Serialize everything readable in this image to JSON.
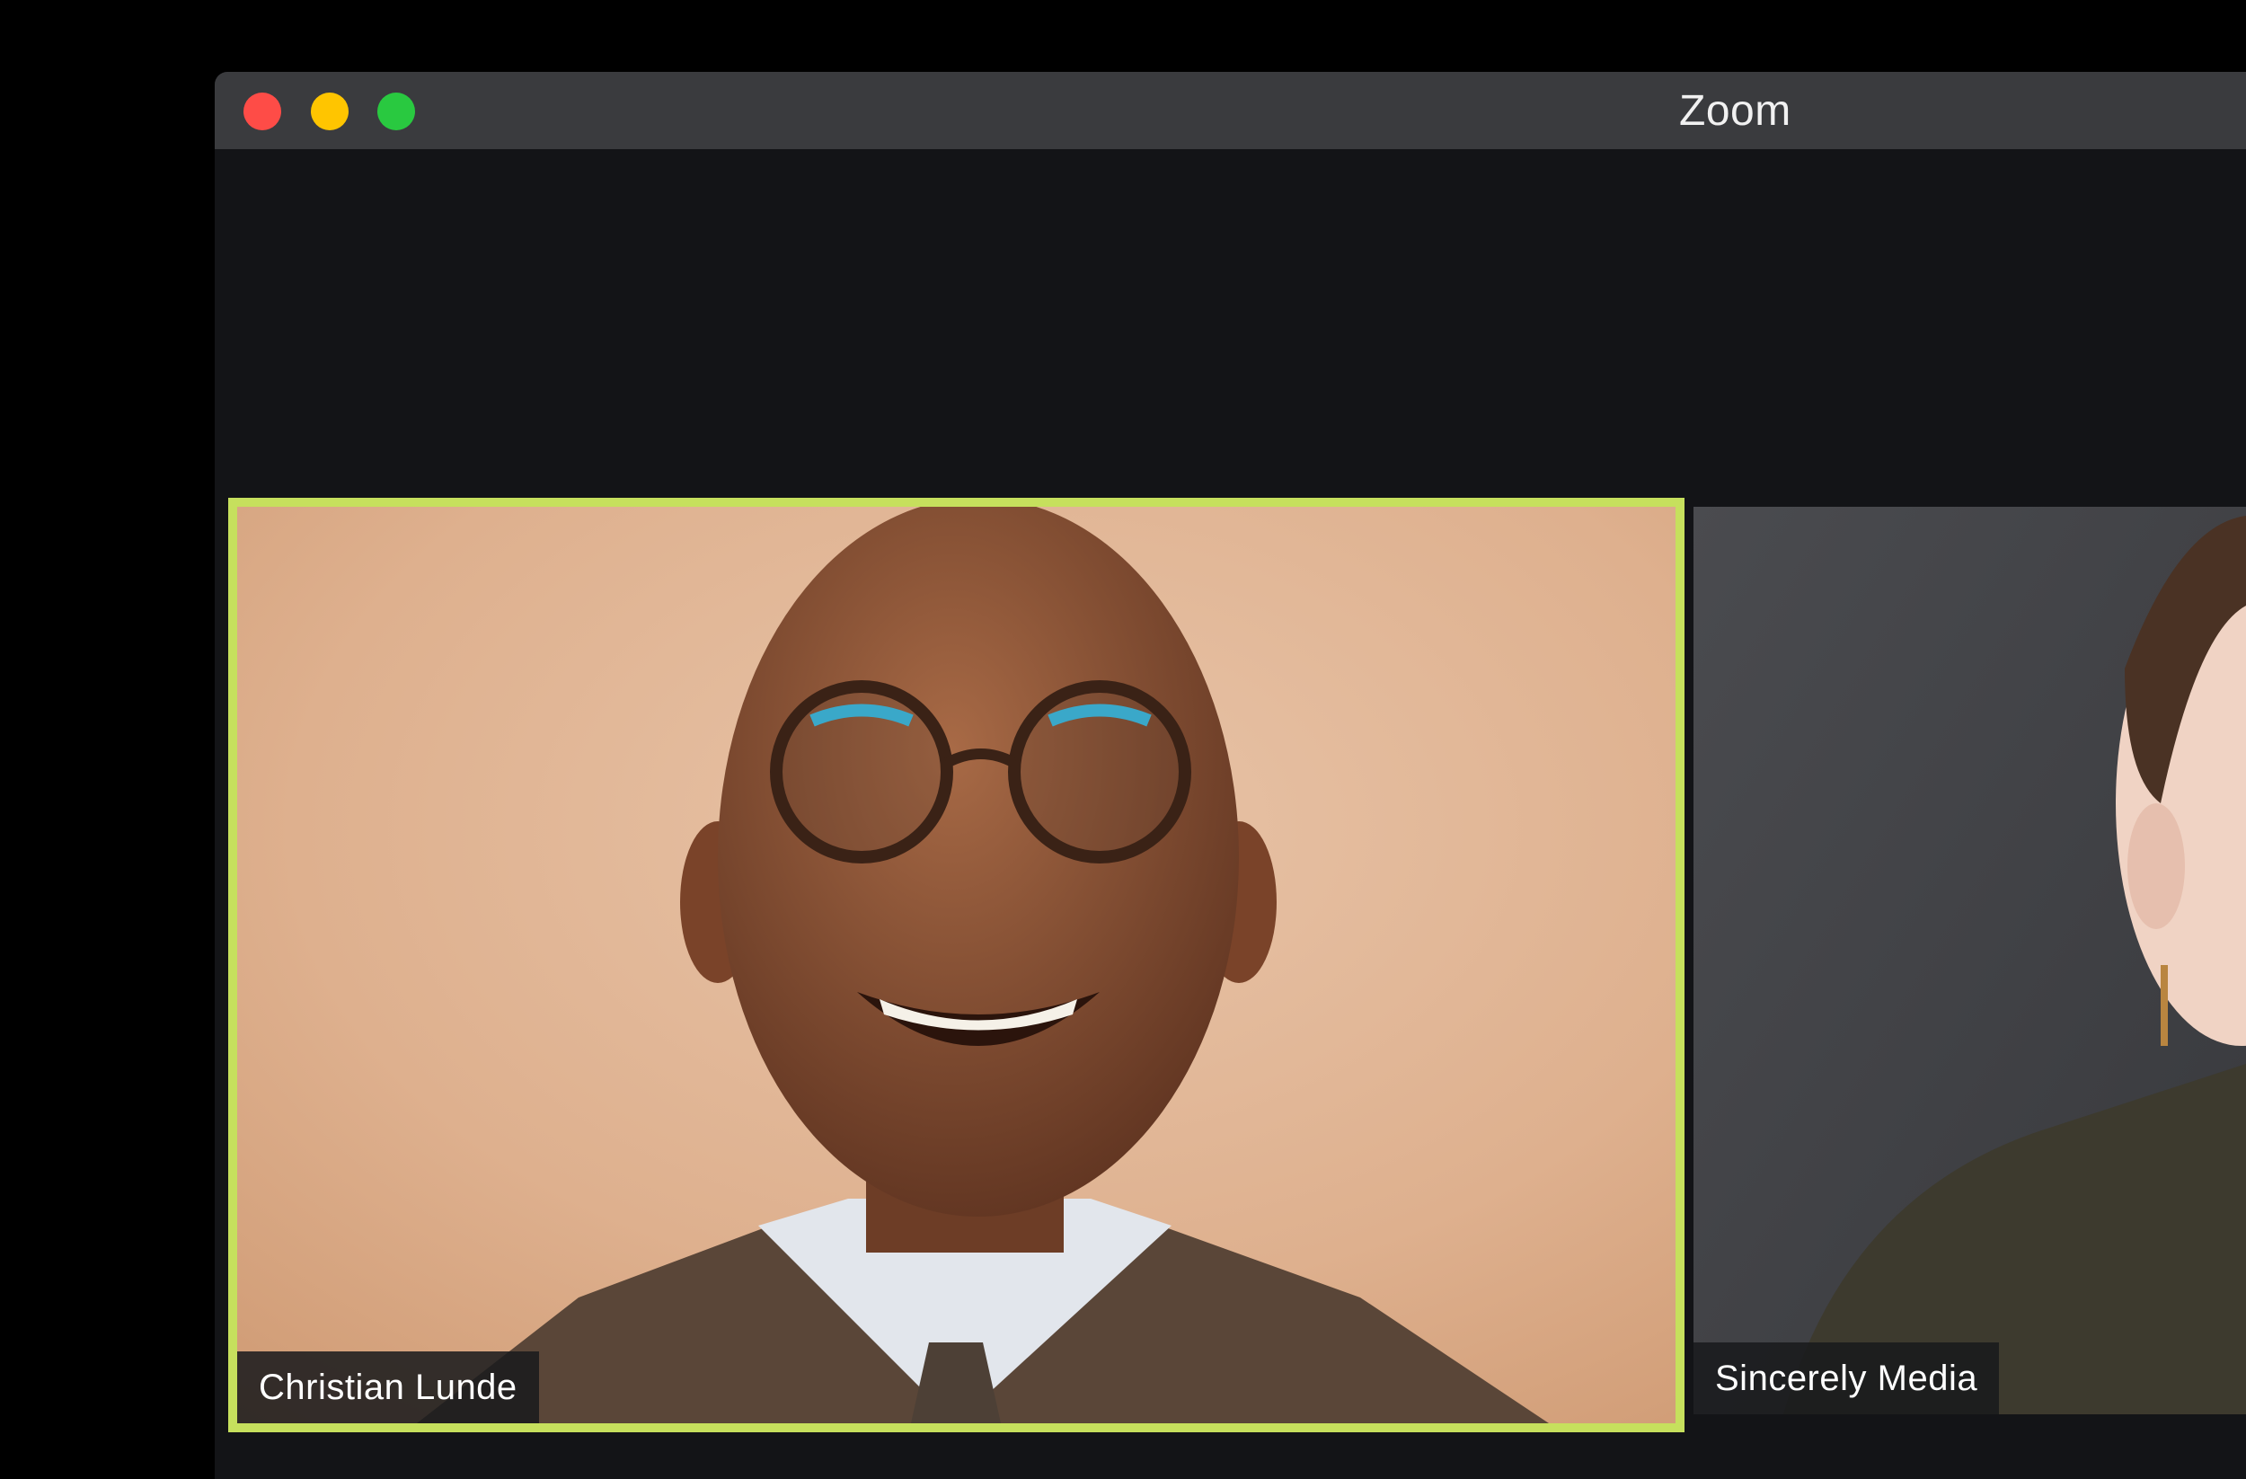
{
  "window": {
    "title": "Zoom"
  },
  "participants": [
    {
      "name": "Christian Lunde",
      "active_speaker": true
    },
    {
      "name": "Sincerely Media",
      "active_speaker": false
    }
  ],
  "colors": {
    "active_speaker_border": "#c6e05d",
    "traffic_close": "#fe4c47",
    "traffic_minimize": "#ffc500",
    "traffic_zoom": "#29c940",
    "window_bg": "#131417",
    "titlebar_bg": "#3a3b3e"
  },
  "icons": [
    "close-traffic-light",
    "minimize-traffic-light",
    "zoom-traffic-light"
  ]
}
